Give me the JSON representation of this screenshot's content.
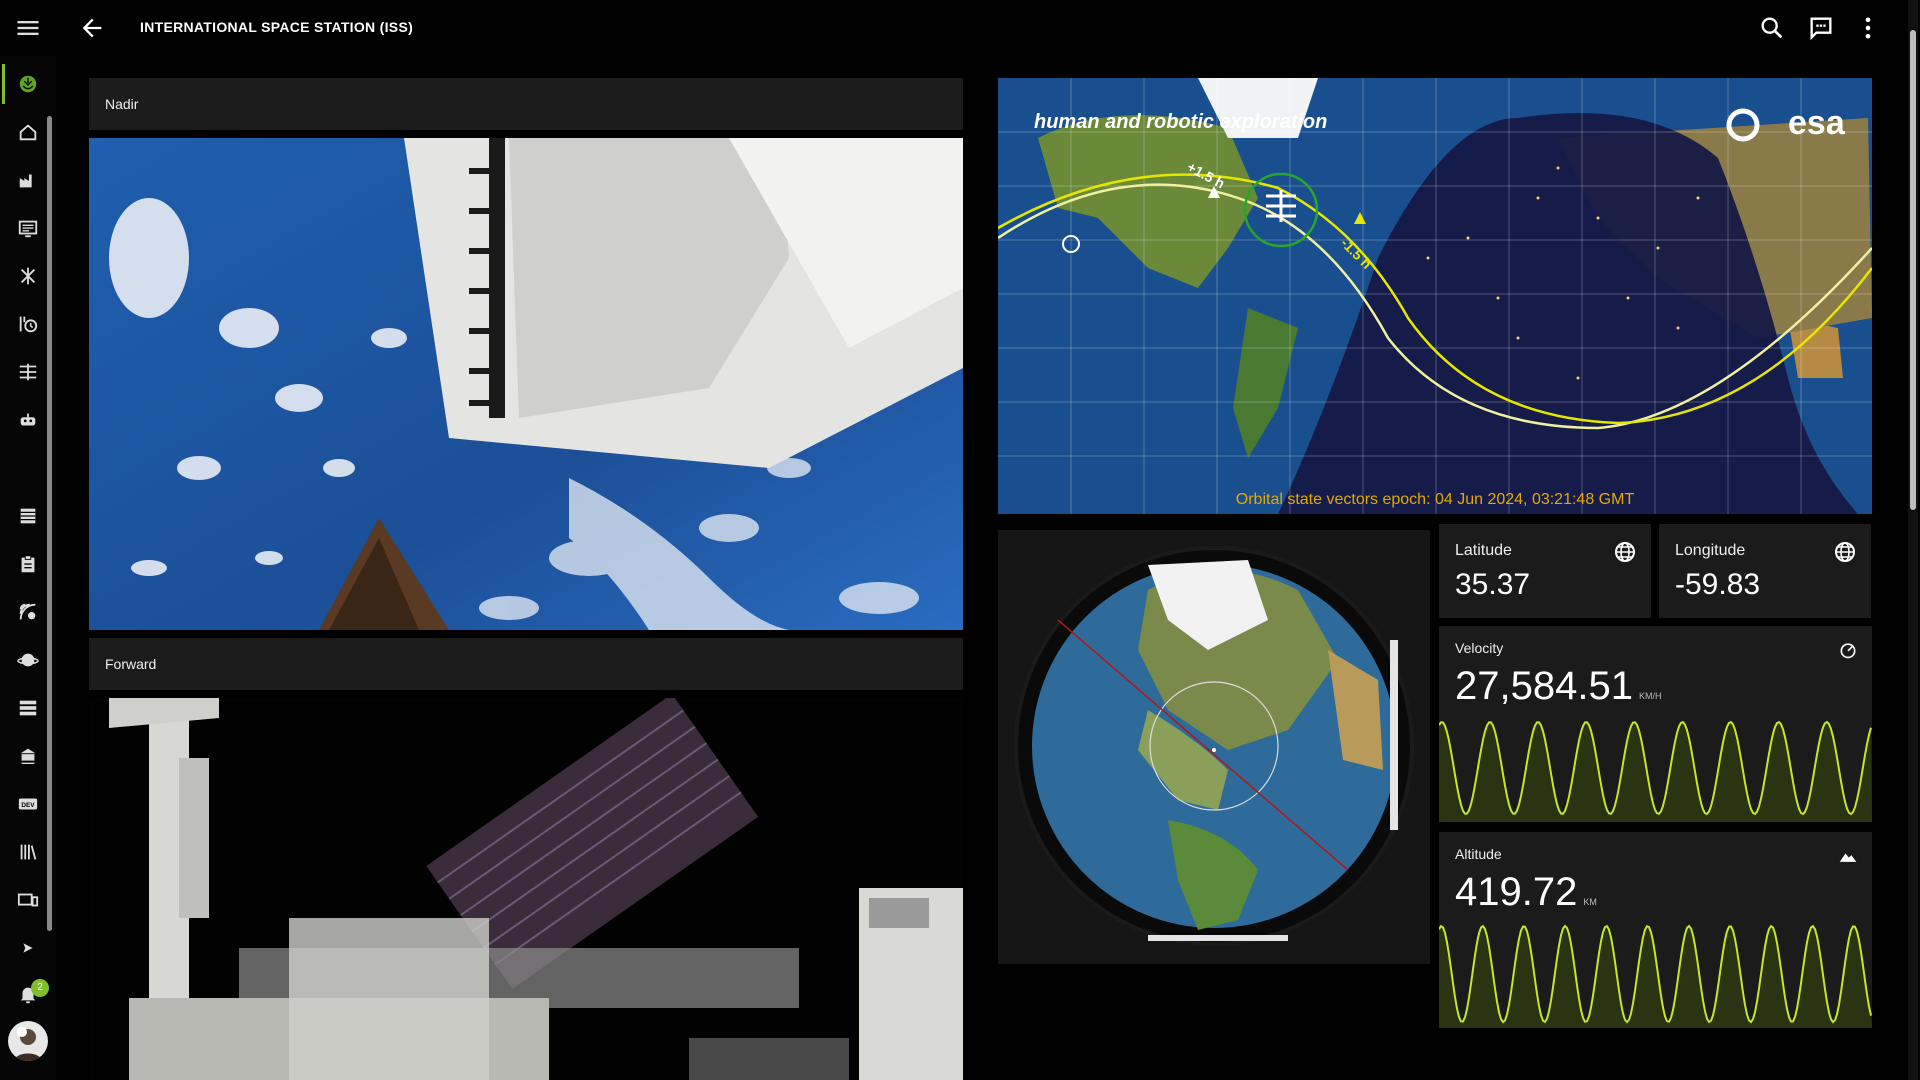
{
  "header": {
    "title": "INTERNATIONAL SPACE STATION (ISS)"
  },
  "icons": {
    "menu": "hamburger-menu-icon",
    "back": "back-arrow-icon",
    "search": "search-icon",
    "chat": "chat-icon",
    "more": "more-vert-icon"
  },
  "rail": {
    "notification_count": "2"
  },
  "feeds": {
    "nadir_label": "Nadir",
    "forward_label": "Forward"
  },
  "map": {
    "banner_text": "human and robotic exploration",
    "logo_text": "esa",
    "plus_label": "+1.5 h",
    "minus_label": "-1.5 h",
    "epoch_text": "Orbital state vectors epoch: 04 Jun 2024, 03:21:48 GMT"
  },
  "stats": {
    "latitude_label": "Latitude",
    "latitude_value": "35.37",
    "longitude_label": "Longitude",
    "longitude_value": "-59.83",
    "velocity_label": "Velocity",
    "velocity_value": "27,584.51",
    "velocity_unit": "KM/H",
    "altitude_label": "Altitude",
    "altitude_value": "419.72",
    "altitude_unit": "KM"
  },
  "colors": {
    "accent": "#7fbf2a",
    "chart_line": "#c7e52a",
    "chart_fill": "#2a3412",
    "panel": "#1b1b1b"
  }
}
